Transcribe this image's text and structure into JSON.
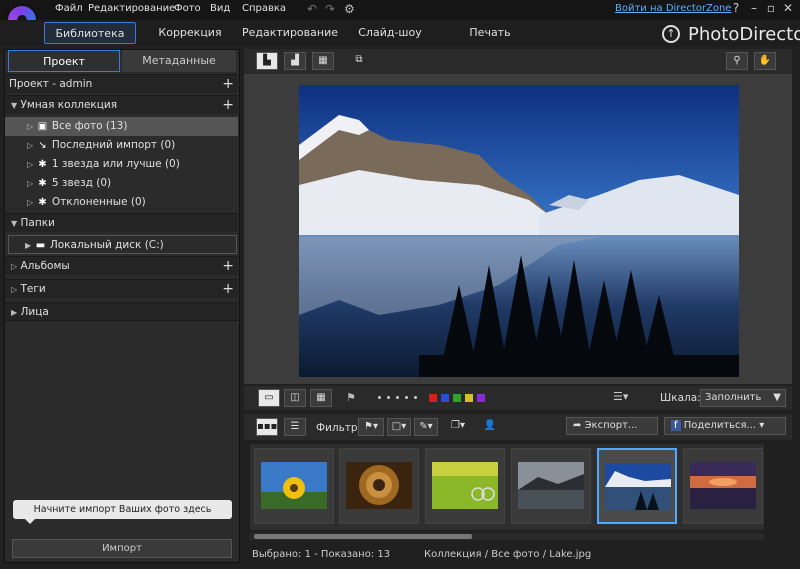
{
  "app": {
    "brand": "PhotoDirector"
  },
  "menu": [
    "Файл",
    "Редактирование",
    "Фото",
    "Вид",
    "Справка"
  ],
  "login_link": "Войти на DirectorZone",
  "main_tabs": [
    "Библиотека",
    "Коррекция",
    "Редактирование",
    "Слайд-шоу",
    "Печать"
  ],
  "left_tabs": [
    "Проект",
    "Метаданные"
  ],
  "project": "Проект - admin",
  "smart": {
    "title": "Умная коллекция",
    "items": [
      "Все фото (13)",
      "Последний импорт (0)",
      "1 звезда или лучше (0)",
      "5 звезд (0)",
      "Отклоненные (0)"
    ]
  },
  "folders": {
    "title": "Папки",
    "items": [
      "Локальный диск (C:)"
    ]
  },
  "albums": "Альбомы",
  "tags": "Теги",
  "faces": "Лица",
  "hint": "Начните импорт Ваших фото здесь",
  "import_label": "Импорт",
  "scale": {
    "label": "Шкала:",
    "value": "Заполнить"
  },
  "filter_label": "Фильтр:",
  "export_label": "Экспорт...",
  "share_label": "Поделиться...",
  "swatch_colors": [
    "#d42020",
    "#2a4fd0",
    "#2aa82a",
    "#d8c020",
    "#8a2ad0"
  ],
  "status": {
    "selection": "Выбрано: 1 - Показано: 13",
    "path": "Коллекция / Все фото / Lake.jpg"
  }
}
